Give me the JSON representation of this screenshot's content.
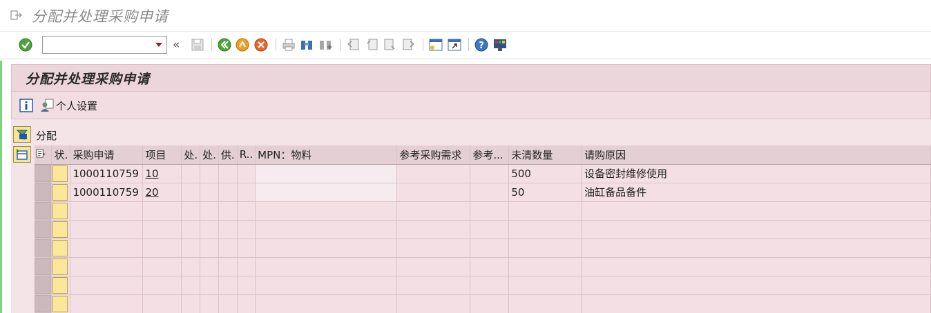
{
  "window": {
    "title": "分配并处理采购申请"
  },
  "toolbar": {
    "command_value": "",
    "buttons": [
      "enter-icon",
      "back-icon",
      "exit-icon",
      "cancel-icon",
      "print-icon",
      "find-icon",
      "find-next-icon",
      "first-page-icon",
      "prev-page-icon",
      "next-page-icon",
      "last-page-icon",
      "new-session-icon",
      "shortcut-icon",
      "help-icon",
      "layout-icon"
    ]
  },
  "screen": {
    "title": "分配并处理采购申请",
    "personal_settings": "个人设置",
    "assign_label": "分配"
  },
  "table": {
    "columns": [
      "状.",
      "采购申请",
      "项目",
      "处.",
      "处.",
      "供.",
      "R..",
      "MPN：物料",
      "参考采购需求",
      "参考...",
      "未清数量",
      "请购原因"
    ],
    "rows": [
      {
        "pr": "1000110759",
        "item": "10",
        "qty": "500",
        "reason": "设备密封维修使用"
      },
      {
        "pr": "1000110759",
        "item": "20",
        "qty": "50",
        "reason": "油缸备品备件"
      }
    ]
  },
  "colors": {
    "accent": "#f6e49a",
    "panel": "#f4e4e8",
    "header": "#ecd5db",
    "grid_header": "#e3cfd4"
  }
}
